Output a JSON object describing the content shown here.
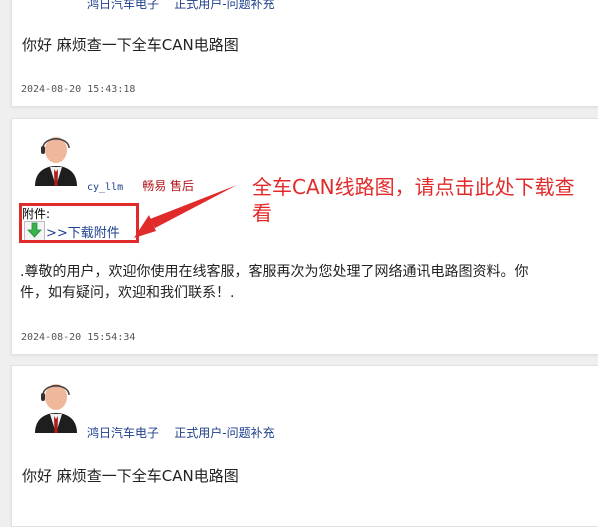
{
  "posts": [
    {
      "user": "鸿日汽车电子",
      "role": "正式用户-问题补充",
      "message": "你好  麻烦查一下全车CAN电路图",
      "time": "2024-08-20 15:43:18"
    },
    {
      "user": "cy_llm",
      "role": "畅易 售后",
      "attachment_label": "附件:",
      "attachment_link": ">>下载附件",
      "message_line1": ".尊敬的用户，欢迎你使用在线客服，客服再次为您处理了网络通讯电路图资料。你",
      "message_line2": "件，如有疑问，欢迎和我们联系！.",
      "time": "2024-08-20 15:54:34"
    },
    {
      "user": "鸿日汽车电子",
      "role": "正式用户-问题补充",
      "message": "你好  麻烦查一下全车CAN电路图"
    }
  ],
  "annotation": {
    "text": "全车CAN线路图，请点击此处下载查看",
    "color": "#e12b2b"
  }
}
